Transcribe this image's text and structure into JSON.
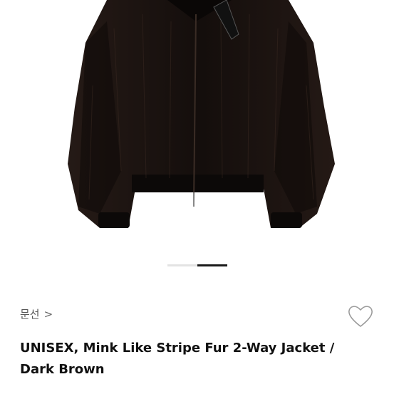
{
  "product": {
    "brand": "문선",
    "brand_chevron": ">",
    "title": "UNISEX, Mink Like Stripe Fur 2-Way Jacket / Dark Brown",
    "image_icon": "jacket-photo",
    "like_icon": "heart-outline-icon"
  },
  "gallery": {
    "current_page": 2,
    "total_pages": 2
  },
  "colors": {
    "fur": "#1d1512",
    "accent": "#1a1a1a"
  }
}
